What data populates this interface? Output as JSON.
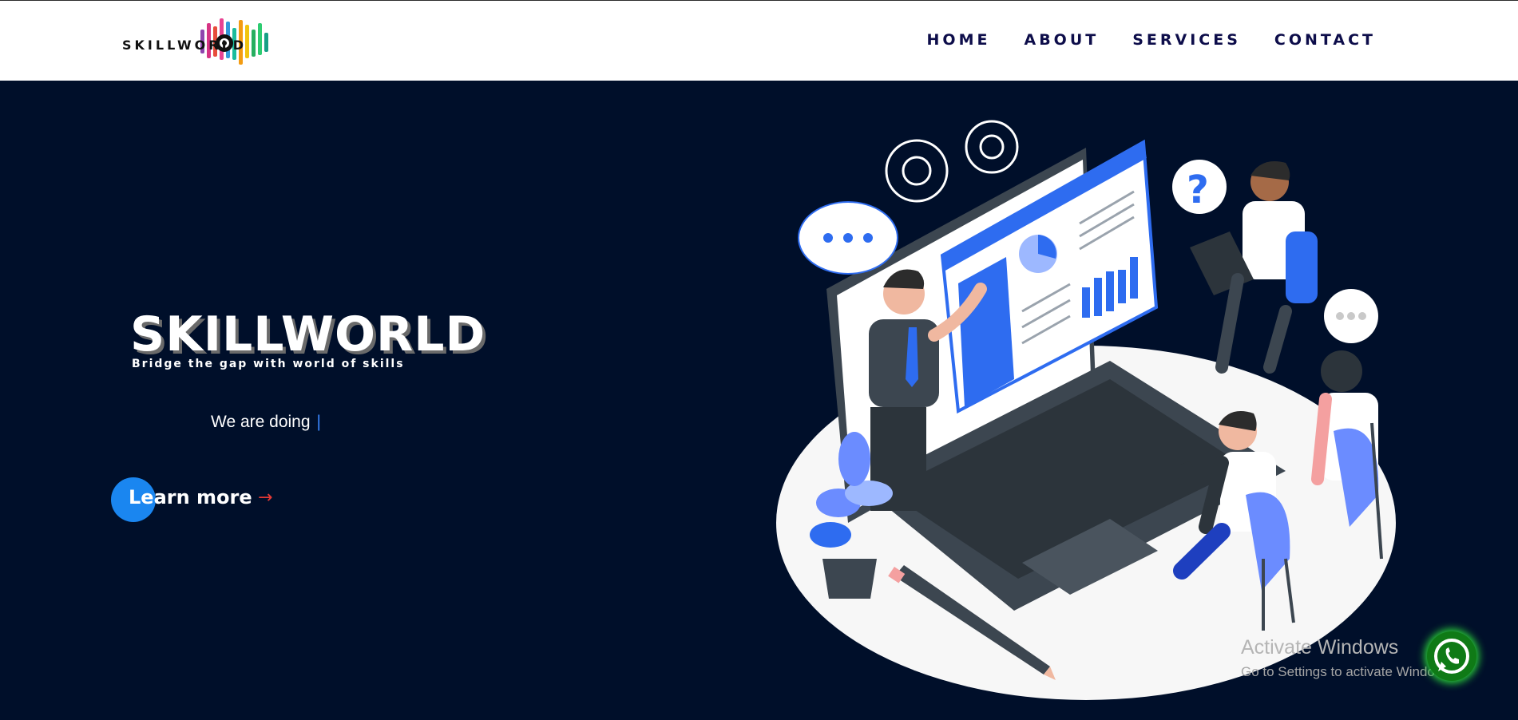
{
  "brand": {
    "logo_text": "SKILLWORLD"
  },
  "nav": {
    "items": [
      "HOME",
      "ABOUT",
      "SERVICES",
      "CONTACT"
    ]
  },
  "hero": {
    "title": "SKILLWORLD",
    "tagline": "Bridge the gap with world of skills",
    "doing_text": "We are doing",
    "cursor": "|",
    "cta_label": "Learn more",
    "cta_arrow": "→"
  },
  "system": {
    "watermark_title": "Activate Windows",
    "watermark_subtitle": "Go to Settings to activate Windows."
  },
  "colors": {
    "hero_background": "#000f2a",
    "nav_text": "#0d0d4a",
    "accent_blue": "#1a86f0",
    "arrow_red": "#e53935",
    "whatsapp_green": "#0f7a16"
  },
  "icons": {
    "cta": "arrow-right-icon",
    "chat": "whatsapp-icon",
    "gear": "gear-icon"
  }
}
